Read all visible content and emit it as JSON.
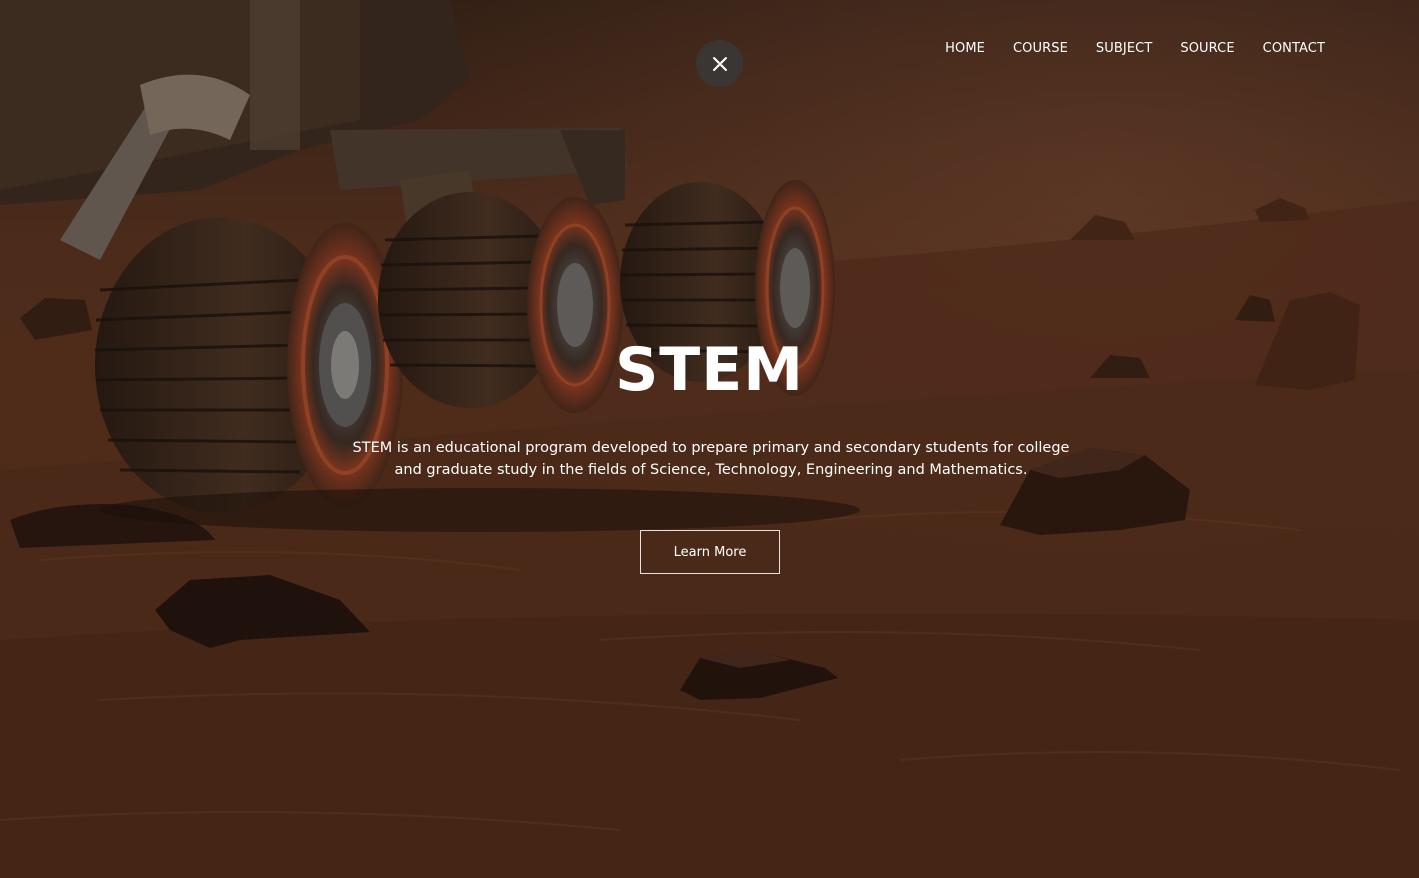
{
  "header": {
    "nav": [
      {
        "label": "HOME"
      },
      {
        "label": "COURSE"
      },
      {
        "label": "SUBJECT"
      },
      {
        "label": "SOURCE"
      },
      {
        "label": "CONTACT"
      }
    ],
    "close_icon": "close-icon"
  },
  "hero": {
    "title": "STEM",
    "description_line1": "STEM is an educational program developed to prepare primary and secondary students for college",
    "description_line2": "and graduate study in the fields of Science, Technology, Engineering and Mathematics.",
    "cta_label": "Learn More",
    "background_image": "mars-rover-terrain"
  },
  "colors": {
    "text": "#ffffff",
    "close_button_bg": "#3a3634",
    "cta_border": "#e8e2de",
    "terrain_dark": "#3b2215",
    "terrain_mid": "#6a3a22"
  }
}
